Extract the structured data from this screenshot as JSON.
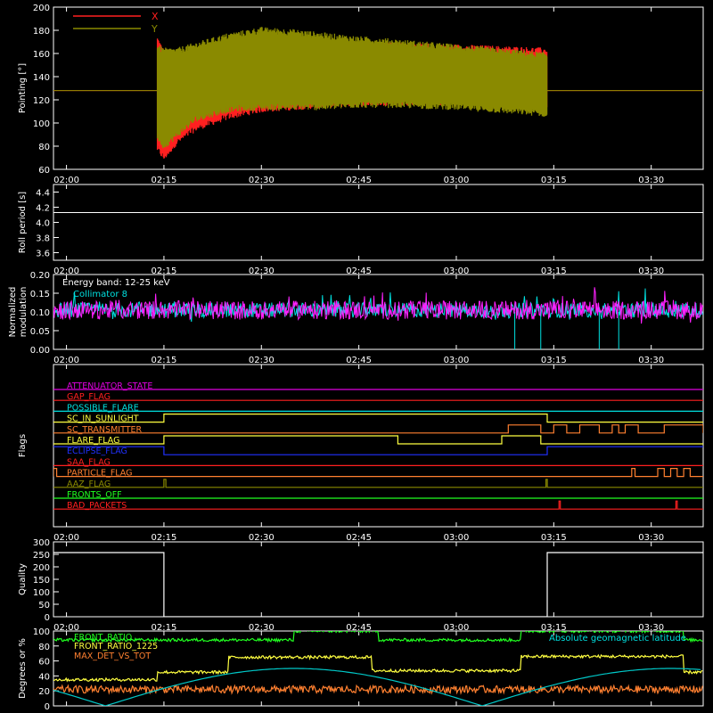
{
  "chart_data": [
    {
      "type": "line",
      "ylabel": "Pointing [°]",
      "ylim": [
        60,
        200
      ],
      "yticks": [
        "60",
        "80",
        "100",
        "120",
        "140",
        "160",
        "180",
        "200"
      ],
      "xticks": [
        "02:00",
        "02:15",
        "02:30",
        "02:45",
        "03:00",
        "03:15",
        "03:30"
      ],
      "x_time_range": [
        "01:58",
        "03:38"
      ],
      "legend_position": "top-left",
      "series": [
        {
          "name": "X",
          "color": "#ff2020",
          "active_range": [
            "02:14",
            "03:14"
          ],
          "envelope": {
            "x": [
              "02:14",
              "02:15",
              "02:17",
              "02:20",
              "02:25",
              "02:30",
              "02:40",
              "02:50",
              "03:00",
              "03:10",
              "03:14"
            ],
            "upper": [
              172,
              160,
              150,
              153,
              158,
              162,
              163,
              167,
              165,
              163,
              162
            ],
            "lower": [
              78,
              70,
              84,
              96,
              106,
              112,
              116,
              118,
              118,
              116,
              116
            ]
          },
          "flat_value": 128
        },
        {
          "name": "Y",
          "color": "#8a8a00",
          "active_range": [
            "02:14",
            "03:14"
          ],
          "envelope": {
            "x": [
              "02:14",
              "02:15",
              "02:17",
              "02:20",
              "02:25",
              "02:30",
              "02:35",
              "02:40",
              "02:45",
              "02:50",
              "03:00",
              "03:10",
              "03:14"
            ],
            "upper": [
              165,
              162,
              162,
              167,
              175,
              180,
              178,
              175,
              172,
              170,
              165,
              160,
              158
            ],
            "lower": [
              88,
              80,
              90,
              104,
              112,
              114,
              114,
              114,
              116,
              116,
              114,
              110,
              108
            ]
          },
          "flat_value": 128
        }
      ]
    },
    {
      "type": "line",
      "ylabel": "Roll period [s]",
      "ylim": [
        3.5,
        4.5
      ],
      "yticks": [
        "3.6",
        "3.8",
        "4.0",
        "4.2",
        "4.4"
      ],
      "xticks": [
        "02:00",
        "02:15",
        "02:30",
        "02:45",
        "03:00",
        "03:15",
        "03:30"
      ],
      "series": [
        {
          "color": "#ffffff",
          "value": 4.13
        }
      ]
    },
    {
      "type": "line",
      "ylabel": [
        "Normalized",
        "modulation"
      ],
      "ylim": [
        0,
        0.2
      ],
      "yticks": [
        "0.00",
        "0.05",
        "0.10",
        "0.15",
        "0.20"
      ],
      "xticks": [
        "02:00",
        "02:15",
        "02:30",
        "02:45",
        "03:00",
        "03:15",
        "03:30"
      ],
      "annotations": [
        "Energy band: 12-25 keV",
        "Collimator 8"
      ],
      "series": [
        {
          "color": "#00e0e0",
          "mean": 0.105,
          "noise": 0.02,
          "dropouts": [
            "03:09",
            "03:13",
            "03:22",
            "03:25"
          ]
        },
        {
          "color": "#ff20ff",
          "mean": 0.105,
          "noise": 0.025
        }
      ]
    },
    {
      "type": "line",
      "ylabel": "Flags",
      "xticks": [
        "02:00",
        "02:15",
        "02:30",
        "02:45",
        "03:00",
        "03:15",
        "03:30"
      ],
      "flags": [
        {
          "name": "ATTENUATOR_STATE",
          "color": "#e000e0",
          "segments": []
        },
        {
          "name": "GAP_FLAG",
          "color": "#ff2020",
          "segments": []
        },
        {
          "name": "POSSIBLE_FLARE",
          "color": "#00e0e0",
          "segments": []
        },
        {
          "name": "SC_IN_SUNLIGHT",
          "color": "#ffff40",
          "segments": [
            [
              "02:15",
              "03:14"
            ]
          ]
        },
        {
          "name": "SC_TRANSMITTER",
          "color": "#ff8030",
          "segments": [
            [
              "03:08",
              "03:13"
            ],
            [
              "03:15",
              "03:17"
            ],
            [
              "03:19",
              "03:22"
            ],
            [
              "03:24",
              "03:25"
            ],
            [
              "03:26",
              "03:28"
            ],
            [
              "03:32",
              "03:38"
            ]
          ]
        },
        {
          "name": "FLARE_FLAG",
          "color": "#ffff40",
          "segments": [
            [
              "02:15",
              "02:51"
            ],
            [
              "03:07",
              "03:13"
            ]
          ]
        },
        {
          "name": "ECLIPSE_FLAG",
          "color": "#2030ff",
          "invert_segments": [
            [
              "02:15",
              "03:14"
            ]
          ]
        },
        {
          "name": "SAA_FLAG",
          "color": "#ff2020",
          "segments": []
        },
        {
          "name": "PARTICLE_FLAG",
          "color": "#ff8030",
          "segments": [
            [
              "01:58",
              "01:58.5"
            ],
            [
              "03:27",
              "03:27.5"
            ],
            [
              "03:31",
              "03:32"
            ],
            [
              "03:33",
              "03:34"
            ],
            [
              "03:35",
              "03:36"
            ]
          ]
        },
        {
          "name": "AAZ_FLAG",
          "color": "#8a8a00",
          "segments": [
            [
              "02:15",
              "02:15.3"
            ],
            [
              "03:13.8",
              "03:14"
            ]
          ]
        },
        {
          "name": "FRONTS_OFF",
          "color": "#20ff20",
          "segments": []
        },
        {
          "name": "BAD_PACKETS",
          "color": "#ff2020",
          "segments": [
            [
              "03:15.8",
              "03:16"
            ],
            [
              "03:33.8",
              "03:34"
            ]
          ]
        }
      ]
    },
    {
      "type": "line",
      "ylabel": "Quality",
      "ylim": [
        0,
        300
      ],
      "yticks": [
        "0",
        "50",
        "100",
        "150",
        "200",
        "250",
        "300"
      ],
      "xticks": [
        "02:00",
        "02:15",
        "02:30",
        "02:45",
        "03:00",
        "03:15",
        "03:30"
      ],
      "series": [
        {
          "color": "#ffffff",
          "x": [
            "01:58",
            "02:15",
            "02:15",
            "03:14",
            "03:14",
            "03:38"
          ],
          "y": [
            257,
            257,
            0,
            0,
            257,
            257
          ]
        }
      ]
    },
    {
      "type": "line",
      "ylabel": "Degrees or %",
      "ylim": [
        0,
        100
      ],
      "yticks": [
        "0",
        "20",
        "40",
        "60",
        "80",
        "100"
      ],
      "xticks": [
        "02:00",
        "02:15",
        "02:30",
        "02:45",
        "03:00",
        "03:15",
        "03:30"
      ],
      "annotations": [
        "Absolute geomagnetic latitude"
      ],
      "series": [
        {
          "name": "FRONT_RATIO",
          "color": "#20ff20",
          "x": [
            "01:58",
            "02:35",
            "02:35",
            "02:48",
            "02:48",
            "03:10",
            "03:10",
            "03:35",
            "03:35",
            "03:38"
          ],
          "y": [
            88,
            88,
            100,
            100,
            88,
            88,
            100,
            100,
            88,
            88
          ]
        },
        {
          "name": "FRONT_RATIO_1225",
          "color": "#ffff40",
          "x": [
            "01:58",
            "02:14",
            "02:14",
            "02:25",
            "02:25",
            "02:47",
            "02:47",
            "03:10",
            "03:10",
            "03:35",
            "03:35",
            "03:38"
          ],
          "y": [
            35,
            35,
            45,
            45,
            65,
            65,
            47,
            47,
            66,
            66,
            45,
            45
          ]
        },
        {
          "name": "MAX_DET_VS_TOT",
          "color": "#ff8030",
          "mean": 22
        },
        {
          "name": "Absolute geomagnetic latitude",
          "color": "#00c8c8",
          "x": [
            "01:58",
            "02:06",
            "02:35",
            "03:05",
            "03:34",
            "03:38"
          ],
          "y": [
            25,
            0,
            50,
            0,
            50,
            46
          ]
        }
      ]
    }
  ]
}
